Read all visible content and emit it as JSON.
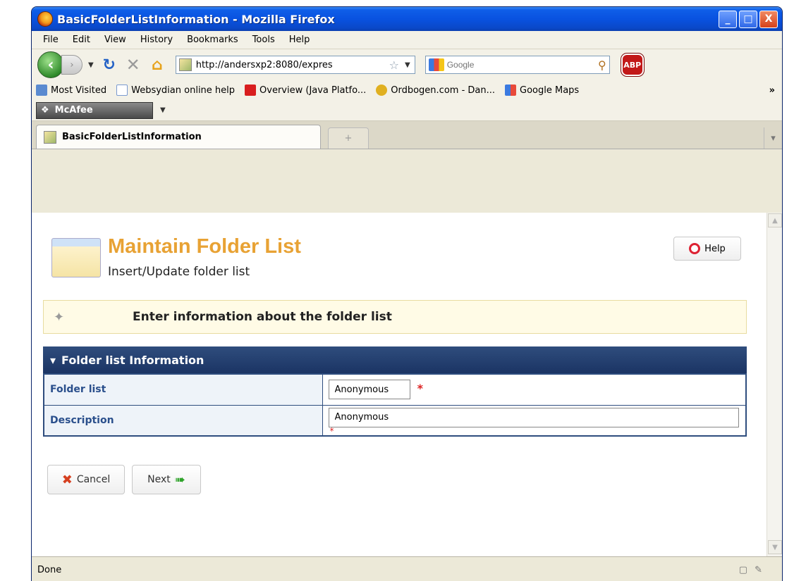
{
  "window": {
    "title": "BasicFolderListInformation - Mozilla Firefox",
    "buttons": {
      "minimize": "_",
      "maximize": "□",
      "close": "X"
    }
  },
  "menubar": [
    {
      "label": "File"
    },
    {
      "label": "Edit"
    },
    {
      "label": "View"
    },
    {
      "label": "History"
    },
    {
      "label": "Bookmarks"
    },
    {
      "label": "Tools"
    },
    {
      "label": "Help"
    }
  ],
  "navbar": {
    "url": "http://andersxp2:8080/expres",
    "search_placeholder": "Google"
  },
  "bookmarks": [
    {
      "label": "Most Visited",
      "color": "#5a8ad0"
    },
    {
      "label": "Websydian online help",
      "color": "#ffffff"
    },
    {
      "label": "Overview (Java Platfo...",
      "color": "#d81e1e"
    },
    {
      "label": "Ordbogen.com - Dan...",
      "color": "#e0b020"
    },
    {
      "label": "Google Maps",
      "color": "#3b7ae0"
    }
  ],
  "bookmarks_more": "»",
  "mcafee": {
    "label": "McAfee"
  },
  "tabs": {
    "active_label": "BasicFolderListInformation",
    "new_tab": "+"
  },
  "page": {
    "title": "Maintain Folder List",
    "subtitle": "Insert/Update folder list",
    "help_label": "Help",
    "info_text": "Enter information about the folder list",
    "panel_title": "Folder list Information",
    "fields": {
      "folder_list_label": "Folder list",
      "folder_list_value": "Anonymous",
      "description_label": "Description",
      "description_value": "Anonymous"
    },
    "required_marker": "*",
    "cancel_label": "Cancel",
    "next_label": "Next"
  },
  "status": {
    "text": "Done"
  }
}
